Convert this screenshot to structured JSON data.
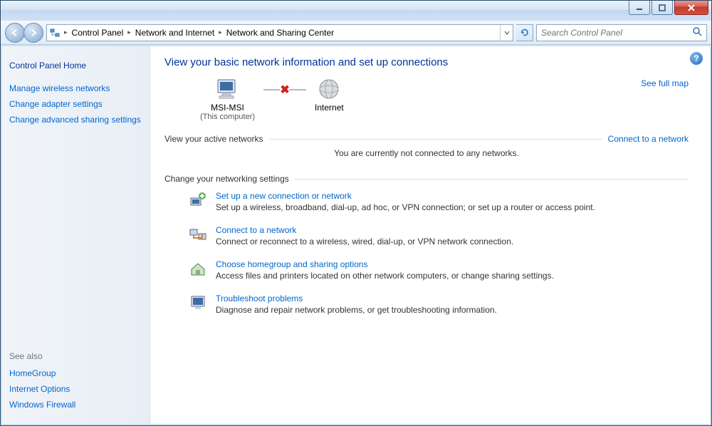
{
  "breadcrumb": {
    "items": [
      "Control Panel",
      "Network and Internet",
      "Network and Sharing Center"
    ]
  },
  "search": {
    "placeholder": "Search Control Panel"
  },
  "sidebar": {
    "home": "Control Panel Home",
    "links": [
      "Manage wireless networks",
      "Change adapter settings",
      "Change advanced sharing settings"
    ],
    "see_also_head": "See also",
    "see_also": [
      "HomeGroup",
      "Internet Options",
      "Windows Firewall"
    ]
  },
  "main": {
    "title": "View your basic network information and set up connections",
    "full_map": "See full map",
    "node_pc": {
      "label": "MSI-MSI",
      "sub": "(This computer)"
    },
    "node_net": {
      "label": "Internet"
    },
    "active_label": "View your active networks",
    "active_link": "Connect to a network",
    "active_msg": "You are currently not connected to any networks.",
    "settings_head": "Change your networking settings",
    "tasks": [
      {
        "title": "Set up a new connection or network",
        "desc": "Set up a wireless, broadband, dial-up, ad hoc, or VPN connection; or set up a router or access point."
      },
      {
        "title": "Connect to a network",
        "desc": "Connect or reconnect to a wireless, wired, dial-up, or VPN network connection."
      },
      {
        "title": "Choose homegroup and sharing options",
        "desc": "Access files and printers located on other network computers, or change sharing settings."
      },
      {
        "title": "Troubleshoot problems",
        "desc": "Diagnose and repair network problems, or get troubleshooting information."
      }
    ]
  }
}
